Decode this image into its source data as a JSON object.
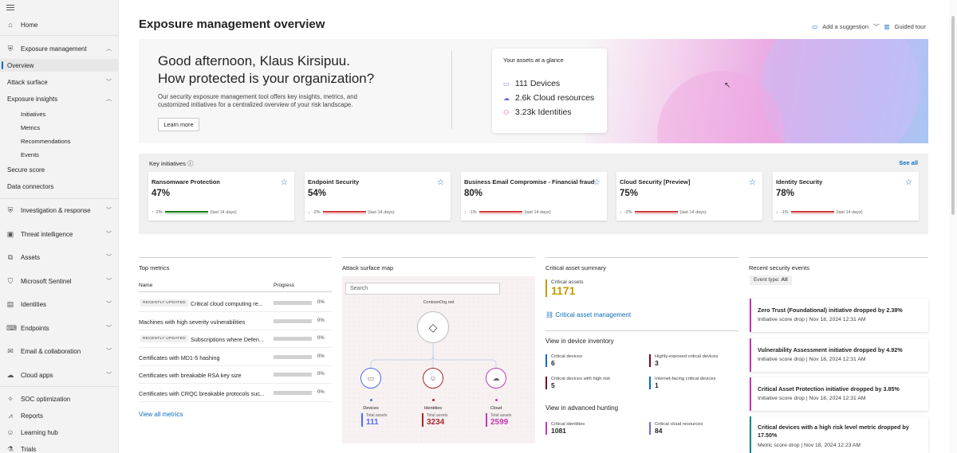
{
  "sidebar": {
    "items": [
      {
        "label": "Home",
        "icon": "home-icon"
      },
      {
        "label": "Exposure management",
        "icon": "shield-icon",
        "chevron": "up"
      },
      {
        "label": "Overview"
      },
      {
        "label": "Attack surface",
        "chevron": "down"
      },
      {
        "label": "Exposure insights",
        "chevron": "up"
      },
      {
        "label": "Initiatives"
      },
      {
        "label": "Metrics"
      },
      {
        "label": "Recommendations"
      },
      {
        "label": "Events"
      },
      {
        "label": "Secure score"
      },
      {
        "label": "Data connectors"
      },
      {
        "label": "Investigation & response",
        "icon": "shield-icon"
      },
      {
        "label": "Threat intelligence",
        "icon": "threat-icon"
      },
      {
        "label": "Assets",
        "icon": "assets-icon"
      },
      {
        "label": "Microsoft Sentinel",
        "icon": "sentinel-icon"
      },
      {
        "label": "Identities",
        "icon": "identities-icon"
      },
      {
        "label": "Endpoints",
        "icon": "endpoints-icon"
      },
      {
        "label": "Email & collaboration",
        "icon": "email-icon"
      },
      {
        "label": "Cloud apps",
        "icon": "cloud-icon"
      },
      {
        "label": "SOC optimization",
        "icon": "soc-icon"
      },
      {
        "label": "Reports",
        "icon": "reports-icon"
      },
      {
        "label": "Learning hub",
        "icon": "learning-icon"
      },
      {
        "label": "Trials",
        "icon": "trials-icon"
      }
    ]
  },
  "header": {
    "title": "Exposure management overview",
    "add_suggestion": "Add a suggestion",
    "guided_tour": "Guided tour"
  },
  "hero": {
    "greeting_line1": "Good afternoon, Klaus Kirsipuu.",
    "greeting_line2": "How protected is your organization?",
    "description": "Our security exposure management tool offers key insights, metrics, and customized initiatives for a centralized overview of your risk landscape.",
    "learn_more": "Learn more",
    "glance_title": "Your assets at a glance",
    "glance": [
      {
        "value": "111",
        "label": "Devices",
        "icon": "devices-icon"
      },
      {
        "value": "2.6k",
        "label": "Cloud resources",
        "icon": "cloud-icon"
      },
      {
        "value": "3.23k",
        "label": "Identities",
        "icon": "identities-icon"
      }
    ]
  },
  "key_initiatives": {
    "title": "Key initiatives",
    "see_all": "See all",
    "period": "(last 14 days)",
    "cards": [
      {
        "name": "Ransomware Protection",
        "value": "47%",
        "change": "2%",
        "direction": "up"
      },
      {
        "name": "Endpoint Security",
        "value": "54%",
        "change": "-2%",
        "direction": "down"
      },
      {
        "name": "Business Email Compromise - Financial fraud",
        "value": "80%",
        "change": "-1%",
        "direction": "down"
      },
      {
        "name": "Cloud Security [Preview]",
        "value": "75%",
        "change": "-2%",
        "direction": "down"
      },
      {
        "name": "Identity Security",
        "value": "78%",
        "change": "-1%",
        "direction": "down"
      }
    ]
  },
  "top_metrics": {
    "title": "Top metrics",
    "col_name": "Name",
    "col_progress": "Progress",
    "badge_label": "RECENTLY UPDATED",
    "rows": [
      {
        "badge": true,
        "name": "Critical cloud computing re...",
        "progress": 0,
        "progress_label": "0%"
      },
      {
        "badge": false,
        "name": "Machines with high severity vulnerabilities",
        "progress": 0,
        "progress_label": "0%"
      },
      {
        "badge": true,
        "name": "Subscriptions where Defen...",
        "progress": 0,
        "progress_label": "0%"
      },
      {
        "badge": false,
        "name": "Certificates with MD1-5 hashing",
        "progress": 0,
        "progress_label": "0%"
      },
      {
        "badge": false,
        "name": "Certificates with breakable RSA key size",
        "progress": 0,
        "progress_label": "0%"
      },
      {
        "badge": false,
        "name": "Certificates with CRQC breakable protocols suc...",
        "progress": 0,
        "progress_label": "0%"
      }
    ],
    "view_all": "View all metrics"
  },
  "attack_surface_map": {
    "title": "Attack surface map",
    "search_placeholder": "Search",
    "org": "ContosoOrg.net",
    "nodes": [
      {
        "label": "Devices",
        "total_label": "Total assets",
        "total": "111",
        "color": "#4f6bed"
      },
      {
        "label": "Identities",
        "total_label": "Total assets",
        "total": "3234",
        "color": "#a4262c"
      },
      {
        "label": "Cloud",
        "total_label": "Total assets",
        "total": "2599",
        "color": "#c239b3"
      }
    ]
  },
  "critical_asset_summary": {
    "title": "Critical asset summary",
    "assets_label": "Critical assets",
    "assets_value": "1171",
    "link": "Critical asset management",
    "inventory_title": "View in device inventory",
    "inventory": [
      {
        "label": "Critical devices",
        "value": "6",
        "color": "#0f6cbd"
      },
      {
        "label": "Highly-exposed critical devices",
        "value": "3",
        "color": "#750b1c"
      },
      {
        "label": "Critical devices with high risk",
        "value": "5",
        "color": "#750b1c"
      },
      {
        "label": "Internet-facing critical devices",
        "value": "1",
        "color": "#0f6cbd"
      }
    ],
    "hunting_title": "View in advanced hunting",
    "hunting": [
      {
        "label": "Critical identities",
        "value": "1081",
        "color": "#c239b3"
      },
      {
        "label": "Critical cloud resources",
        "value": "84",
        "color": "#8764b8"
      }
    ]
  },
  "recent_events": {
    "title": "Recent security events",
    "filter_label": "Event type:",
    "filter_value": "All",
    "events": [
      {
        "title": "Zero Trust (Foundational) initiative dropped by 2.38%",
        "meta": "Initiative score drop | Nov 18, 2024 12:31 AM",
        "color": "#c239b3"
      },
      {
        "title": "Vulnerability Assessment initiative dropped by 4.92%",
        "meta": "Initiative score drop | Nov 18, 2024 12:31 AM",
        "color": "#c239b3"
      },
      {
        "title": "Critical Asset Protection initiative dropped by 3.85%",
        "meta": "Initiative score drop | Nov 18, 2024 12:31 AM",
        "color": "#c239b3"
      },
      {
        "title": "Critical devices with a high risk level metric dropped by 17.50%",
        "meta": "Metric score drop | Nov 18, 2024 12:23 AM",
        "color": "#038387"
      }
    ]
  }
}
